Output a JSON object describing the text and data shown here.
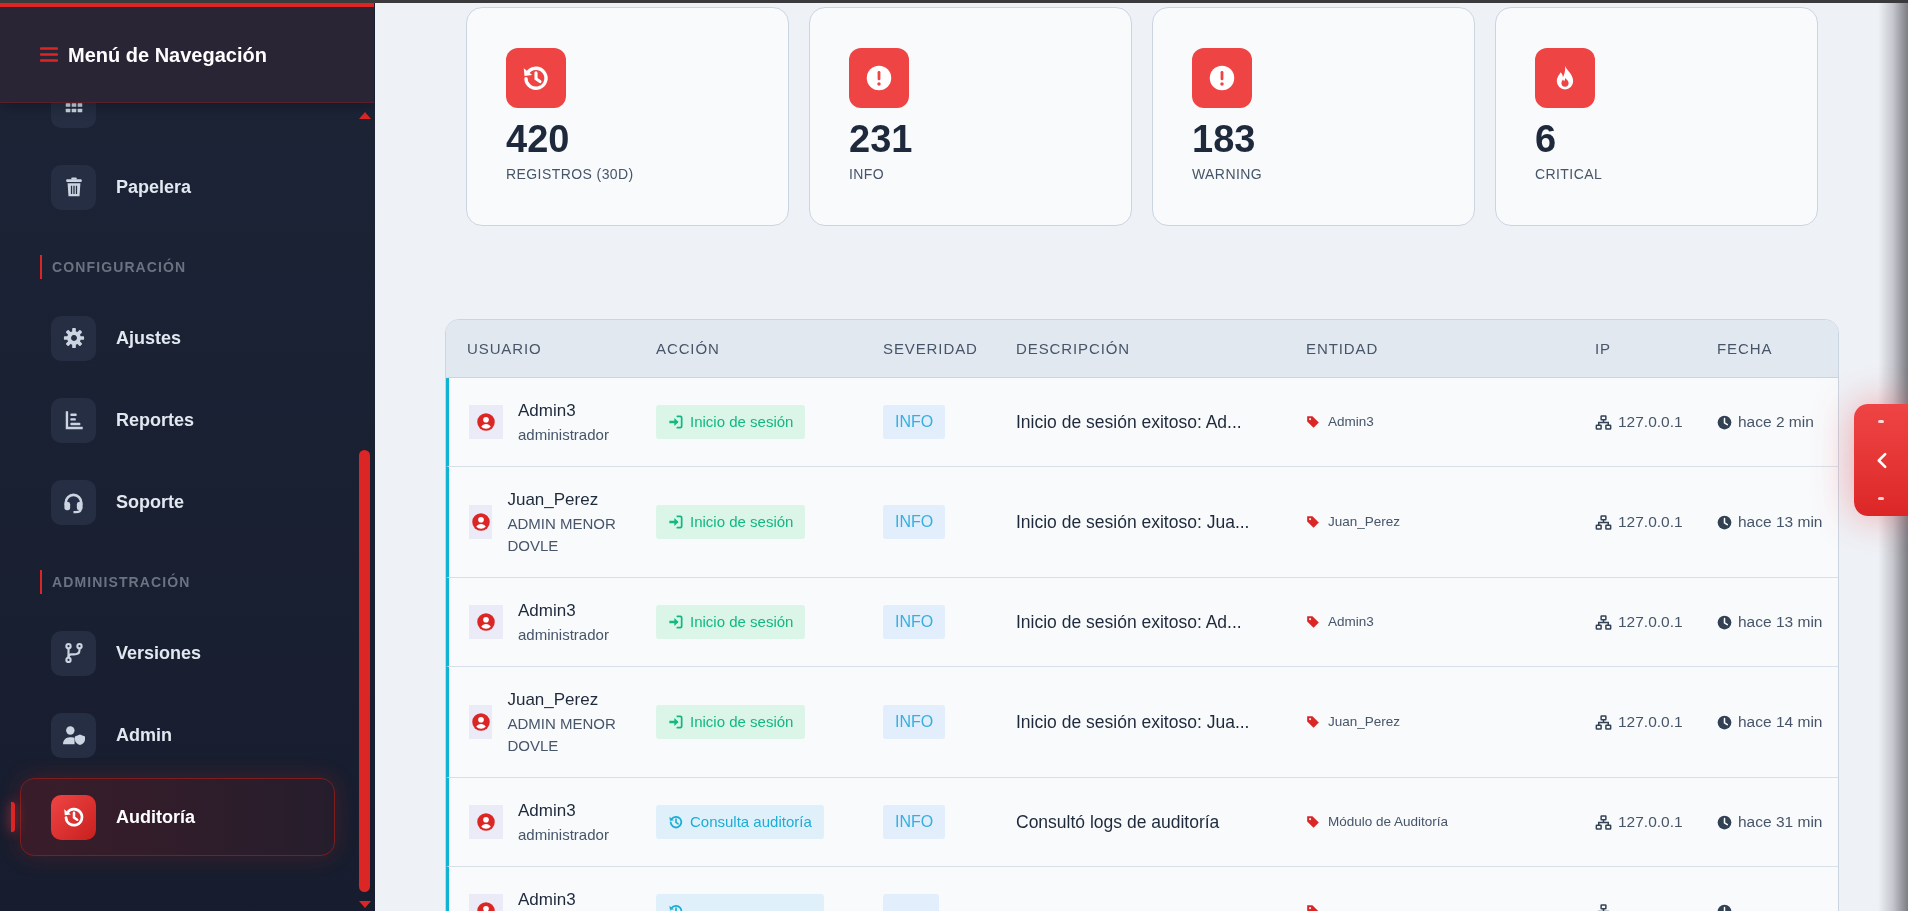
{
  "sidebar": {
    "title": "Menú de Navegación",
    "sections": [
      {
        "items": [
          {
            "label": "Papelera",
            "selected": false
          }
        ]
      },
      {
        "heading": "CONFIGURACIÓN",
        "items": [
          {
            "label": "Ajustes",
            "selected": false
          },
          {
            "label": "Reportes",
            "selected": false
          },
          {
            "label": "Soporte",
            "selected": false
          }
        ]
      },
      {
        "heading": "ADMINISTRACIÓN",
        "items": [
          {
            "label": "Versiones",
            "selected": false
          },
          {
            "label": "Admin",
            "selected": false
          },
          {
            "label": "Auditoría",
            "selected": true
          }
        ]
      }
    ]
  },
  "stats": [
    {
      "value": "420",
      "label": "REGISTROS (30D)"
    },
    {
      "value": "231",
      "label": "INFO"
    },
    {
      "value": "183",
      "label": "WARNING"
    },
    {
      "value": "6",
      "label": "CRITICAL"
    }
  ],
  "table": {
    "columns": [
      "USUARIO",
      "ACCIÓN",
      "SEVERIDAD",
      "DESCRIPCIÓN",
      "ENTIDAD",
      "IP",
      "FECHA"
    ],
    "rows": [
      {
        "user": "Admin3",
        "role": "administrador",
        "action": {
          "kind": "login",
          "label": "Inicio de sesión"
        },
        "severity": "INFO",
        "description": "Inicio de sesión exitoso: Ad...",
        "entity": "Admin3",
        "ip": "127.0.0.1",
        "time": "hace 2 min"
      },
      {
        "user": "Juan_Perez",
        "role": "ADMIN MENOR DOVLE",
        "action": {
          "kind": "login",
          "label": "Inicio de sesión"
        },
        "severity": "INFO",
        "description": "Inicio de sesión exitoso: Jua...",
        "entity": "Juan_Perez",
        "ip": "127.0.0.1",
        "time": "hace 13 min"
      },
      {
        "user": "Admin3",
        "role": "administrador",
        "action": {
          "kind": "login",
          "label": "Inicio de sesión"
        },
        "severity": "INFO",
        "description": "Inicio de sesión exitoso: Ad...",
        "entity": "Admin3",
        "ip": "127.0.0.1",
        "time": "hace 13 min"
      },
      {
        "user": "Juan_Perez",
        "role": "ADMIN MENOR DOVLE",
        "action": {
          "kind": "login",
          "label": "Inicio de sesión"
        },
        "severity": "INFO",
        "description": "Inicio de sesión exitoso: Jua...",
        "entity": "Juan_Perez",
        "ip": "127.0.0.1",
        "time": "hace 14 min"
      },
      {
        "user": "Admin3",
        "role": "administrador",
        "action": {
          "kind": "query",
          "label": "Consulta auditoría"
        },
        "severity": "INFO",
        "description": "Consultó logs de auditoría",
        "entity": "Módulo de Auditoría",
        "ip": "127.0.0.1",
        "time": "hace 31 min"
      },
      {
        "user": "Admin3",
        "action": {
          "kind": "query"
        }
      }
    ]
  }
}
